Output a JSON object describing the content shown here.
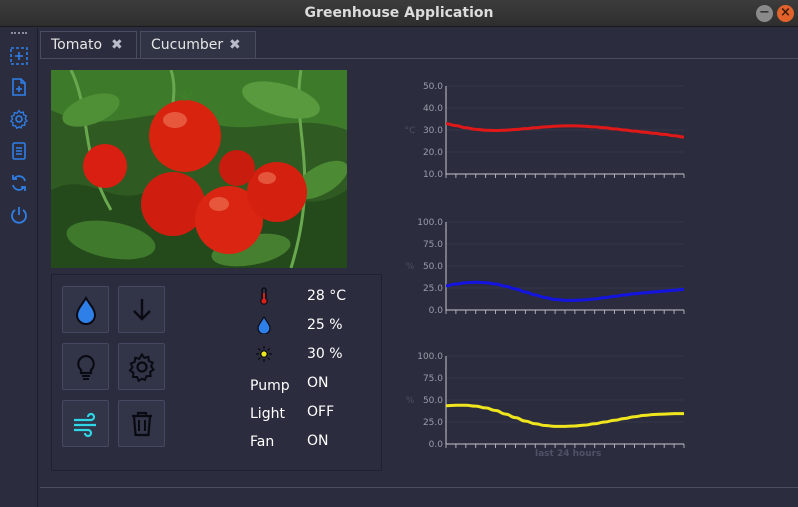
{
  "window": {
    "title": "Greenhouse Application"
  },
  "sidebar": {
    "items": [
      {
        "icon": "select-add-icon"
      },
      {
        "icon": "new-document-icon"
      },
      {
        "icon": "gear-icon"
      },
      {
        "icon": "list-document-icon"
      },
      {
        "icon": "refresh-icon"
      },
      {
        "icon": "power-icon"
      }
    ]
  },
  "tabs": [
    {
      "label": "Tomato",
      "active": true
    },
    {
      "label": "Cucumber",
      "active": false
    }
  ],
  "controls": {
    "buttons": [
      {
        "icon": "water-drop-icon"
      },
      {
        "icon": "arrow-down-icon"
      },
      {
        "icon": "lightbulb-icon"
      },
      {
        "icon": "gear-icon"
      },
      {
        "icon": "wind-icon"
      },
      {
        "icon": "trash-icon"
      }
    ]
  },
  "sensors": {
    "temperature": "28 °C",
    "humidity": "25 %",
    "light": "30 %",
    "pump_label": "Pump",
    "pump_value": "ON",
    "light_label": "Light",
    "light_value": "OFF",
    "fan_label": "Fan",
    "fan_value": "ON"
  },
  "colors": {
    "temp_series": "#e01818",
    "humidity_series": "#1414e0",
    "light_series": "#f0e61e",
    "accent_blue": "#2f7fe8",
    "accent_cyan": "#2fd6e8"
  },
  "chart_data": [
    {
      "type": "line",
      "ylabel": "°C",
      "ylim": [
        10,
        50
      ],
      "yticks": [
        "50.0",
        "40.0",
        "30.0",
        "20.0",
        "10.0"
      ],
      "x": [
        0,
        1,
        2,
        3,
        4,
        5,
        6,
        7,
        8,
        9,
        10,
        11,
        12,
        13,
        14,
        15,
        16,
        17,
        18,
        19,
        20,
        21,
        22,
        23,
        24
      ],
      "values": [
        32.9,
        32.0,
        31.0,
        30.3,
        29.9,
        29.8,
        29.9,
        30.2,
        30.6,
        31.0,
        31.4,
        31.7,
        31.9,
        31.9,
        31.7,
        31.4,
        31.0,
        30.5,
        30.0,
        29.5,
        29.0,
        28.5,
        28.0,
        27.4,
        26.8
      ]
    },
    {
      "type": "line",
      "ylabel": "%",
      "ylim": [
        0,
        100
      ],
      "yticks": [
        "100.0",
        "75.0",
        "50.0",
        "25.0",
        "0.0"
      ],
      "x": [
        0,
        1,
        2,
        3,
        4,
        5,
        6,
        7,
        8,
        9,
        10,
        11,
        12,
        13,
        14,
        15,
        16,
        17,
        18,
        19,
        20,
        21,
        22,
        23,
        24
      ],
      "values": [
        27.5,
        29.5,
        31.0,
        31.5,
        31.0,
        29.5,
        27.0,
        24.0,
        20.5,
        17.0,
        14.0,
        12.0,
        11.0,
        11.0,
        11.5,
        12.5,
        14.0,
        15.5,
        17.0,
        18.5,
        19.5,
        20.5,
        21.5,
        22.5,
        23.5
      ]
    },
    {
      "type": "line",
      "ylabel": "%",
      "ylim": [
        0,
        100
      ],
      "yticks": [
        "100.0",
        "75.0",
        "50.0",
        "25.0",
        "0.0"
      ],
      "x": [
        0,
        1,
        2,
        3,
        4,
        5,
        6,
        7,
        8,
        9,
        10,
        11,
        12,
        13,
        14,
        15,
        16,
        17,
        18,
        19,
        20,
        21,
        22,
        23,
        24
      ],
      "values": [
        43.5,
        44.0,
        44.0,
        43.0,
        41.0,
        38.0,
        34.0,
        30.0,
        26.0,
        23.0,
        21.0,
        20.0,
        20.0,
        20.5,
        21.5,
        23.0,
        25.0,
        27.0,
        29.0,
        31.0,
        32.5,
        33.5,
        34.0,
        34.5,
        34.5
      ],
      "xlabel": "last 24 hours"
    }
  ]
}
